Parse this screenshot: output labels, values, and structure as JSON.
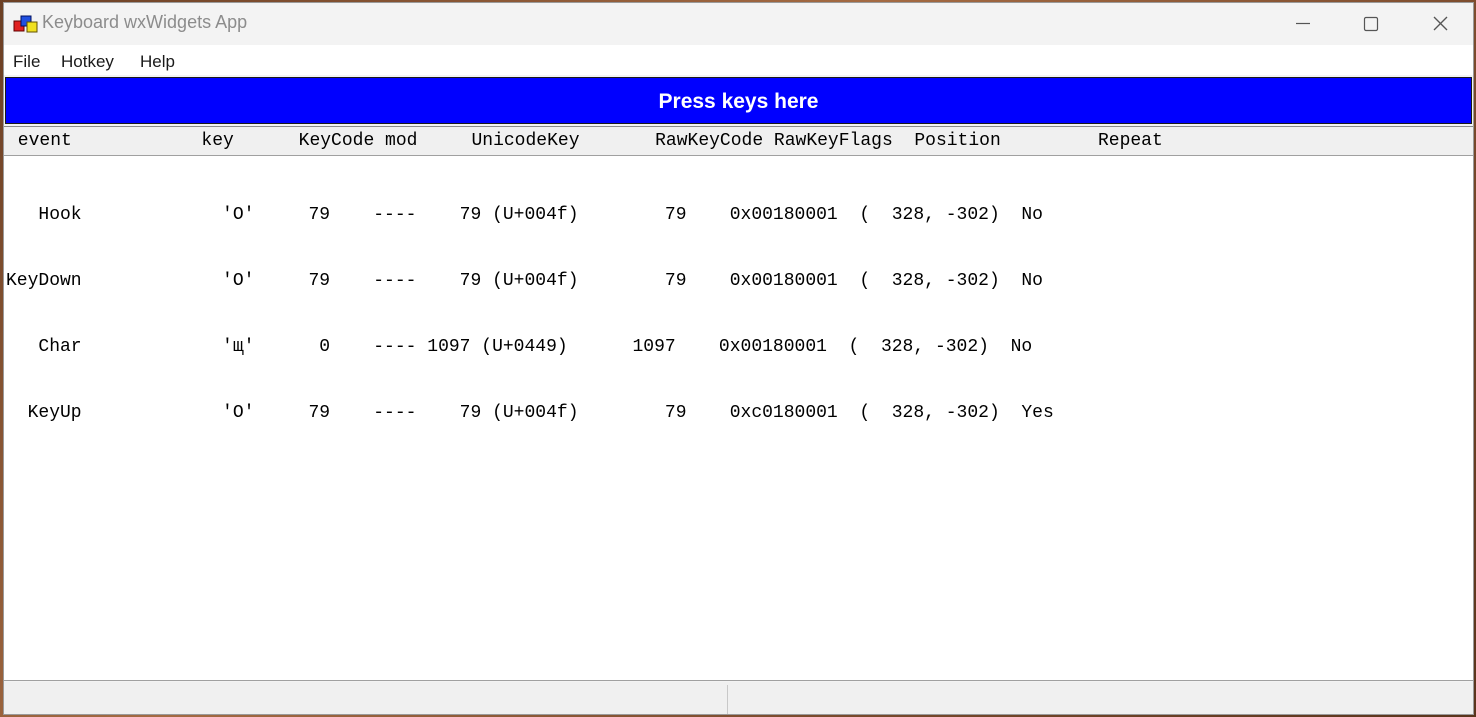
{
  "window": {
    "title": "Keyboard wxWidgets App",
    "icon": "wxwidgets-app-icon",
    "controls": [
      "minimize-icon",
      "maximize-icon",
      "close-icon"
    ]
  },
  "menu": {
    "file": "File",
    "hotkey": "Hotkey",
    "help": "Help"
  },
  "input_area": {
    "label": "Press keys here",
    "background": "#0000ff",
    "text_color": "#ffffff"
  },
  "log": {
    "header": " event            key      KeyCode mod     UnicodeKey       RawKeyCode RawKeyFlags  Position         Repeat",
    "columns": [
      "event",
      "key",
      "KeyCode",
      "mod",
      "UnicodeKey",
      "RawKeyCode",
      "RawKeyFlags",
      "Position",
      "Repeat"
    ],
    "rows": [
      {
        "event": "Hook",
        "key": "'O'",
        "keycode": "79",
        "mod": "----",
        "unicode": "79 (U+004f)",
        "rawkeycode": "79",
        "rawkeyflags": "0x00180001",
        "position": "(  328, -302)",
        "repeat": "No",
        "line": "   Hook             'O'     79    ----    79 (U+004f)        79    0x00180001  (  328, -302)  No"
      },
      {
        "event": "KeyDown",
        "key": "'O'",
        "keycode": "79",
        "mod": "----",
        "unicode": "79 (U+004f)",
        "rawkeycode": "79",
        "rawkeyflags": "0x00180001",
        "position": "(  328, -302)",
        "repeat": "No",
        "line": "KeyDown             'O'     79    ----    79 (U+004f)        79    0x00180001  (  328, -302)  No"
      },
      {
        "event": "Char",
        "key": "'щ'",
        "keycode": "0",
        "mod": "----",
        "unicode": "1097 (U+0449)",
        "rawkeycode": "1097",
        "rawkeyflags": "0x00180001",
        "position": "(  328, -302)",
        "repeat": "No",
        "line": "   Char             'щ'      0    ---- 1097 (U+0449)      1097    0x00180001  (  328, -302)  No"
      },
      {
        "event": "KeyUp",
        "key": "'O'",
        "keycode": "79",
        "mod": "----",
        "unicode": "79 (U+004f)",
        "rawkeycode": "79",
        "rawkeyflags": "0xc0180001",
        "position": "(  328, -302)",
        "repeat": "Yes",
        "line": "  KeyUp             'O'     79    ----    79 (U+004f)        79    0xc0180001  (  328, -302)  Yes"
      }
    ]
  },
  "statusbar": {
    "pane1": "",
    "pane2": ""
  },
  "colors": {
    "title_text": "#8c8c8c",
    "window_bg": "#f3f3f3",
    "log_bg": "#ffffff",
    "header_bg": "#f0f0f0"
  }
}
